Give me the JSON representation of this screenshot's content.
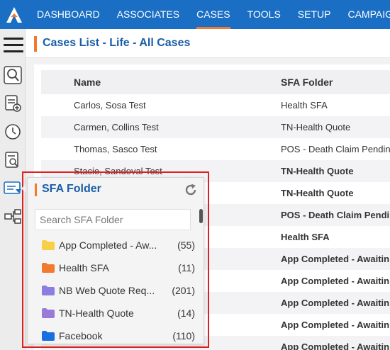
{
  "nav": {
    "items": [
      "DASHBOARD",
      "ASSOCIATES",
      "CASES",
      "TOOLS",
      "SETUP",
      "CAMPAIGN"
    ],
    "active": "CASES",
    "accent": "#f07a2e",
    "bg": "#1a6fc4"
  },
  "header": {
    "title": "Cases List - Life - All Cases"
  },
  "table": {
    "columns": [
      "Name",
      "SFA Folder"
    ],
    "rows": [
      {
        "name": "Carlos, Sosa Test",
        "folder": "Health SFA"
      },
      {
        "name": "Carmen, Collins Test",
        "folder": "TN-Health Quote"
      },
      {
        "name": "Thomas, Sasco Test",
        "folder": "POS - Death Claim Pendin"
      },
      {
        "name": "Stacie, Sandoval Test",
        "folder": "TN-Health Quote"
      },
      {
        "name": "",
        "folder": "TN-Health Quote"
      },
      {
        "name": "",
        "folder": "POS - Death Claim Pendin"
      },
      {
        "name": "",
        "folder": "Health SFA"
      },
      {
        "name": "",
        "folder": "App Completed - Awaitin"
      },
      {
        "name": "",
        "folder": "App Completed - Awaitin"
      },
      {
        "name": "",
        "folder": "App Completed - Awaitin"
      },
      {
        "name": "",
        "folder": "App Completed - Awaitin"
      },
      {
        "name": "",
        "folder": "App Completed - Awaitin"
      }
    ]
  },
  "popup": {
    "title": "SFA Folder",
    "search_placeholder": "Search SFA Folder",
    "folders": [
      {
        "label": "App Completed - Aw...",
        "count": "(55)",
        "color": "#f7d04a"
      },
      {
        "label": "Health SFA",
        "count": "(11)",
        "color": "#f07a2e"
      },
      {
        "label": "NB Web Quote Req...",
        "count": "(201)",
        "color": "#8a7fe0"
      },
      {
        "label": "TN-Health Quote",
        "count": "(14)",
        "color": "#9a7ad8"
      },
      {
        "label": "Facebook",
        "count": "(110)",
        "color": "#1a6fe0"
      }
    ]
  }
}
